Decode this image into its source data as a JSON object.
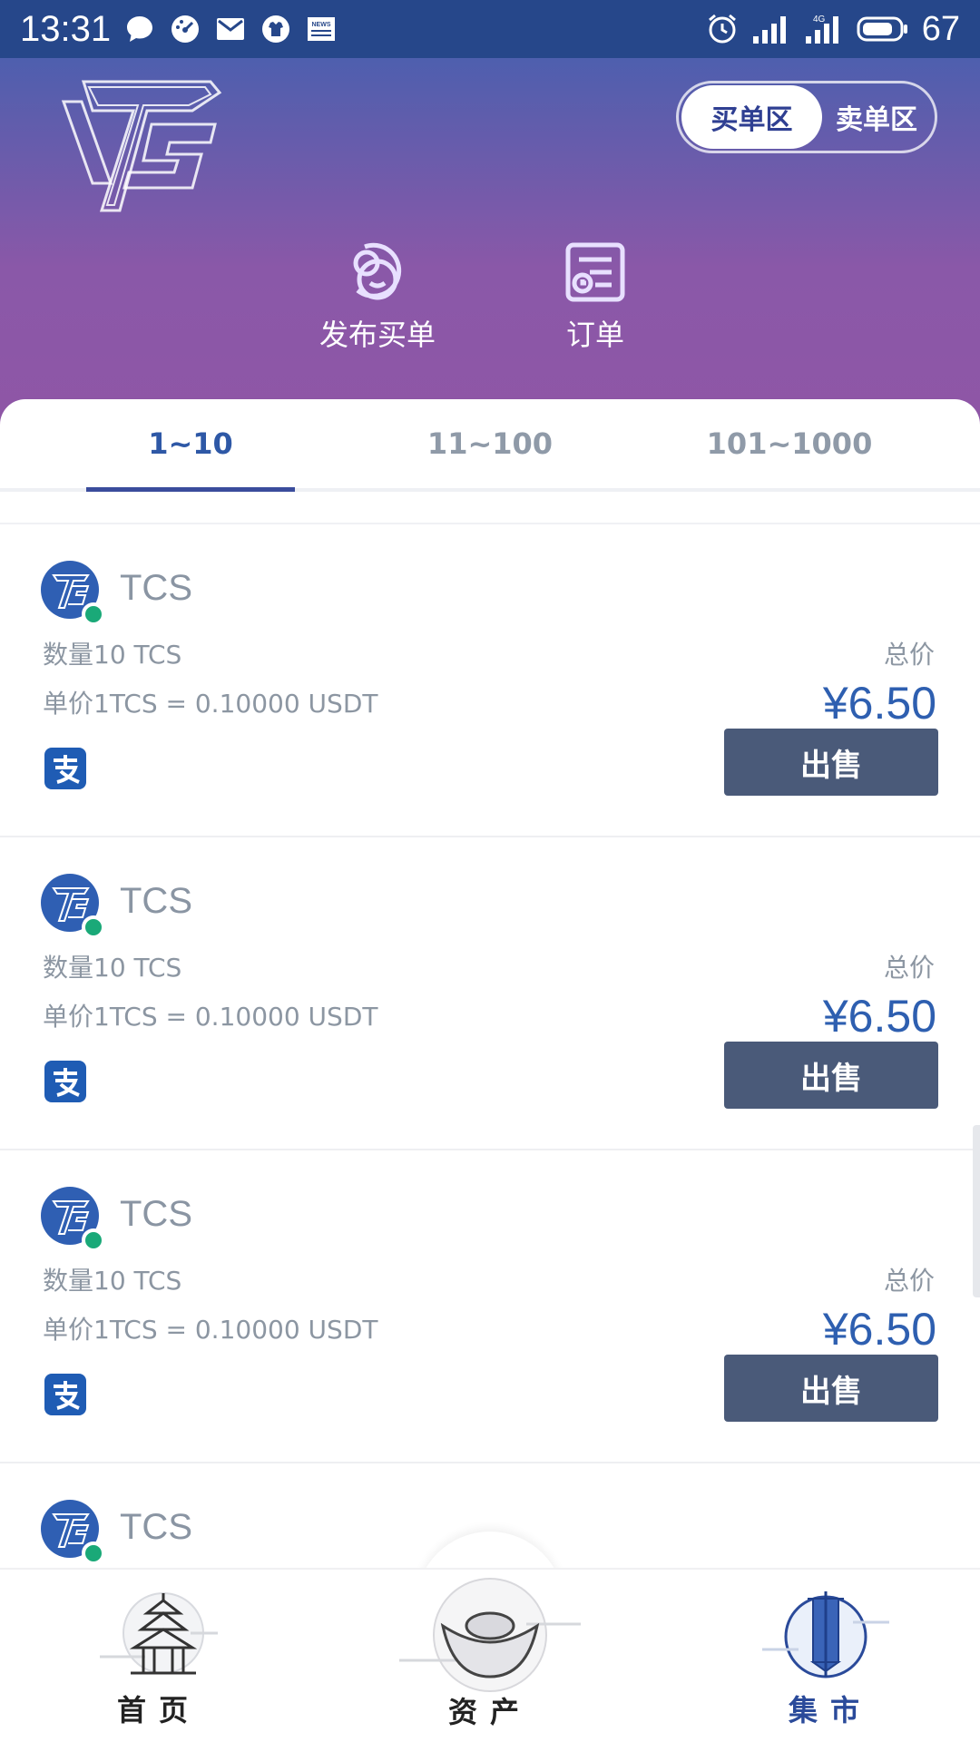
{
  "status_bar": {
    "time": "13:31",
    "battery": "67",
    "icons": [
      "message-icon",
      "speedometer-icon",
      "mail-icon",
      "shirt-icon",
      "news-icon",
      "alarm-icon",
      "signal-icon",
      "signal-4g-icon",
      "battery-icon"
    ],
    "news_text": "NEWS",
    "network_text": "4G"
  },
  "header": {
    "logo": "tcs-logo",
    "toggle": {
      "buy": "买单区",
      "sell": "卖单区",
      "selected": "buy"
    },
    "actions": [
      {
        "label": "发布买单",
        "icon": "publish-order-icon"
      },
      {
        "label": "订单",
        "icon": "orders-icon"
      }
    ]
  },
  "tabs": [
    {
      "label": "1~10",
      "active": true
    },
    {
      "label": "11~100",
      "active": false
    },
    {
      "label": "101~1000",
      "active": false
    }
  ],
  "listings": [
    {
      "name": "TCS",
      "quantity": "数量10 TCS",
      "unit_price": "单价1TCS = 0.10000 USDT",
      "total_label": "总价",
      "total": "¥6.50",
      "button": "出售",
      "payment": "alipay-icon"
    },
    {
      "name": "TCS",
      "quantity": "数量10 TCS",
      "unit_price": "单价1TCS = 0.10000 USDT",
      "total_label": "总价",
      "total": "¥6.50",
      "button": "出售",
      "payment": "alipay-icon"
    },
    {
      "name": "TCS",
      "quantity": "数量10 TCS",
      "unit_price": "单价1TCS = 0.10000 USDT",
      "total_label": "总价",
      "total": "¥6.50",
      "button": "出售",
      "payment": "alipay-icon"
    },
    {
      "name": "TCS"
    }
  ],
  "bottom_nav": [
    {
      "label": "首页",
      "icon": "temple-icon"
    },
    {
      "label": "资产",
      "icon": "gold-ingot-icon"
    },
    {
      "label": "集市",
      "icon": "market-banner-icon",
      "active": true
    }
  ],
  "colors": {
    "status_bar": "#26478a",
    "header_top": "#4e5fae",
    "header_bottom": "#8f56a6",
    "accent_blue": "#2e58a6",
    "sell_button": "#4a5a79",
    "online": "#1aa978"
  }
}
